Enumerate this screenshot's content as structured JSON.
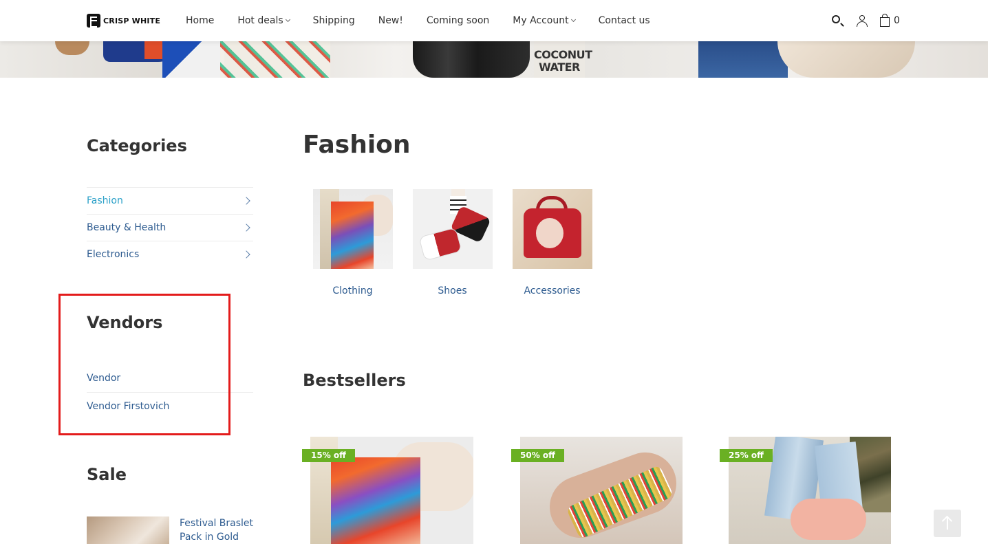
{
  "header": {
    "logo_text": "CRISP WHITE",
    "nav": [
      {
        "label": "Home",
        "has_dropdown": false
      },
      {
        "label": "Hot deals",
        "has_dropdown": true
      },
      {
        "label": "Shipping",
        "has_dropdown": false
      },
      {
        "label": "New!",
        "has_dropdown": false
      },
      {
        "label": "Coming soon",
        "has_dropdown": false
      },
      {
        "label": "My Account",
        "has_dropdown": true
      },
      {
        "label": "Contact us",
        "has_dropdown": false
      }
    ],
    "icons": [
      "search-icon",
      "user-icon",
      "cart-icon"
    ],
    "cart_count": "0"
  },
  "banner": {
    "coconut_text_line1": "COCONUT",
    "coconut_text_line2": "WATER"
  },
  "sidebar": {
    "categories_title": "Categories",
    "categories": [
      {
        "label": "Fashion",
        "active": true
      },
      {
        "label": "Beauty & Health",
        "active": false
      },
      {
        "label": "Electronics",
        "active": false
      }
    ],
    "vendors_title": "Vendors",
    "vendors": [
      {
        "label": "Vendor"
      },
      {
        "label": "Vendor Firstovich"
      }
    ],
    "sale_title": "Sale",
    "sale_item": {
      "name": "Festival Braslet Pack in Gold"
    }
  },
  "main": {
    "title": "Fashion",
    "subcategories": [
      {
        "label": "Clothing"
      },
      {
        "label": "Shoes"
      },
      {
        "label": "Accessories"
      }
    ],
    "bestsellers_title": "Bestsellers",
    "products": [
      {
        "badge": "15% off"
      },
      {
        "badge": "50% off"
      },
      {
        "badge": "25% off"
      }
    ]
  },
  "colors": {
    "accent_link": "#2c5a8f",
    "active_category": "#2aa0c8",
    "badge_green": "#6ab023",
    "highlight_red": "#e31b1b"
  }
}
